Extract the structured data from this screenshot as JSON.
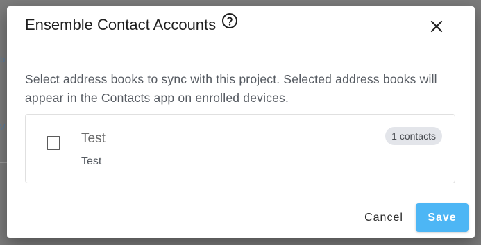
{
  "dialog": {
    "title": "Ensemble Contact Accounts",
    "description": "Select address books to sync with this project. Selected address books will appear in the Contacts app on enrolled devices.",
    "icons": {
      "help": "help-circle-icon",
      "close": "close-icon"
    }
  },
  "address_books": [
    {
      "name": "Test",
      "subtitle": "Test",
      "badge": "1 contacts",
      "checked": false
    }
  ],
  "actions": {
    "cancel_label": "Cancel",
    "save_label": "Save"
  },
  "colors": {
    "accent": "#4db6f5",
    "badge_bg": "#e3e5ea",
    "overlay": "#7b7b7b"
  }
}
